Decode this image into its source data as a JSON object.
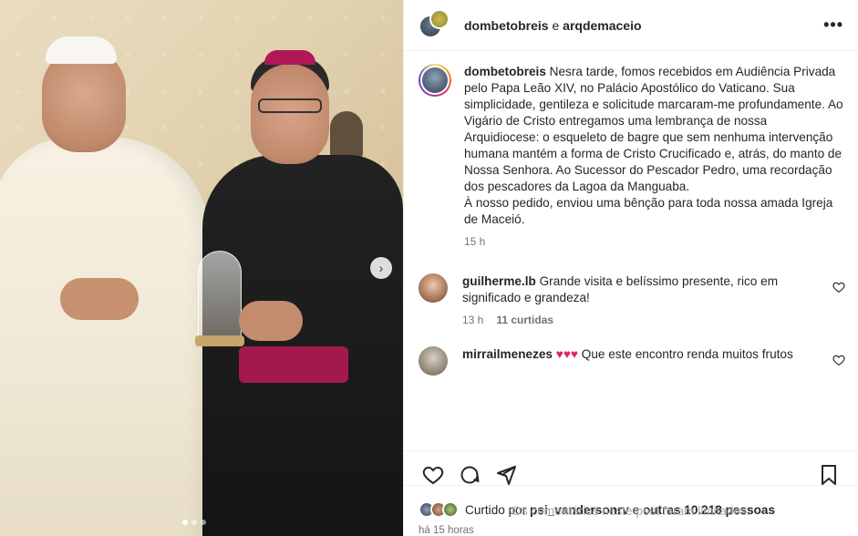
{
  "header": {
    "user1": "dombetobreis",
    "conjunction": "e",
    "user2": "arqdemaceio",
    "more_label": "•••"
  },
  "caption": {
    "username": "dombetobreis",
    "text": "Nesra tarde, fomos recebidos em Audiência Privada pelo Papa Leão XIV, no Palácio Apostólico do Vaticano. Sua simplicidade, gentileza e solicitude marcaram-me profundamente. Ao Vigário de Cristo entregamos uma lembrança de nossa Arquidiocese: o esqueleto de bagre que sem nenhuma intervenção humana mantém a forma de Cristo Crucificado e, atrás, do manto de Nossa Senhora. Ao Sucessor do Pescador Pedro, uma recordação dos pescadores da Lagoa da Manguaba.",
    "text2": "À nosso pedido, enviou uma bênção para toda nossa amada Igreja de Maceió.",
    "time": "15 h"
  },
  "comments": [
    {
      "username": "guilherme.lb",
      "text": "Grande visita e belíssimo presente, rico em significado e grandeza!",
      "time": "13 h",
      "likes": "11 curtidas"
    },
    {
      "username": "mirrailmenezes",
      "emojis": "♥♥♥",
      "text": "Que este encontro renda muitos frutos"
    }
  ],
  "likes": {
    "prefix": "Curtido por",
    "user": "psi_vandersonrv",
    "middle": "e",
    "others": "outras 10.218 pessoas"
  },
  "posted_ago": "há 15 horas",
  "limited_notice": "Os comentários neste post foram limitados.",
  "carousel": {
    "next_label": "›",
    "slide_count": 3,
    "active_slide": 1
  }
}
